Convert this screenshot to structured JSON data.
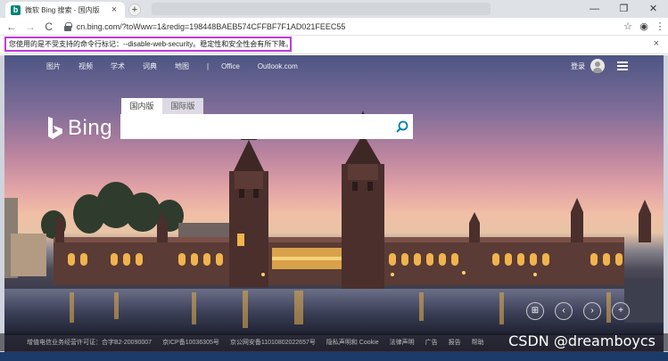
{
  "browser": {
    "tab": {
      "favicon": "b",
      "title": "微软 Bing 搜索 - 国内版",
      "close": "×"
    },
    "new_tab": "+",
    "window_controls": [
      "—",
      "❐",
      "✕"
    ],
    "nav": {
      "back": "←",
      "forward": "→",
      "reload": "C"
    },
    "address": {
      "url": "cn.bing.com/?toWww=1&redig=198448BAEB574CFFBF7F1AD021FEEC55"
    },
    "toolbar_icons": {
      "star": "☆",
      "profile": "◉",
      "menu": "⋮"
    },
    "infobar": {
      "message": "您使用的是不受支持的命令行标记：--disable-web-security。稳定性和安全性会有所下降。",
      "close": "×"
    }
  },
  "bing": {
    "nav_items": [
      "图片",
      "视频",
      "学术",
      "词典",
      "地图",
      "|",
      "Office",
      "Outlook.com"
    ],
    "login": "登录",
    "logo": "Bing",
    "search_tabs": [
      "国内版",
      "国际版"
    ],
    "search": {
      "value": "",
      "placeholder": ""
    },
    "carousel": [
      "⊞",
      "‹",
      "›",
      "+"
    ],
    "footer_links": [
      "增值电信业务经营许可证：合字B2-20090007",
      "京ICP备10036305号",
      "京公网安备11010802022657号",
      "隐私声明和 Cookie",
      "法律声明",
      "广告",
      "报告",
      "帮助"
    ]
  },
  "watermark": "CSDN @dreamboycs",
  "colors": {
    "infobar_border": "#c03ad8",
    "bing_teal": "#008373",
    "search_icon": "#007daa"
  }
}
